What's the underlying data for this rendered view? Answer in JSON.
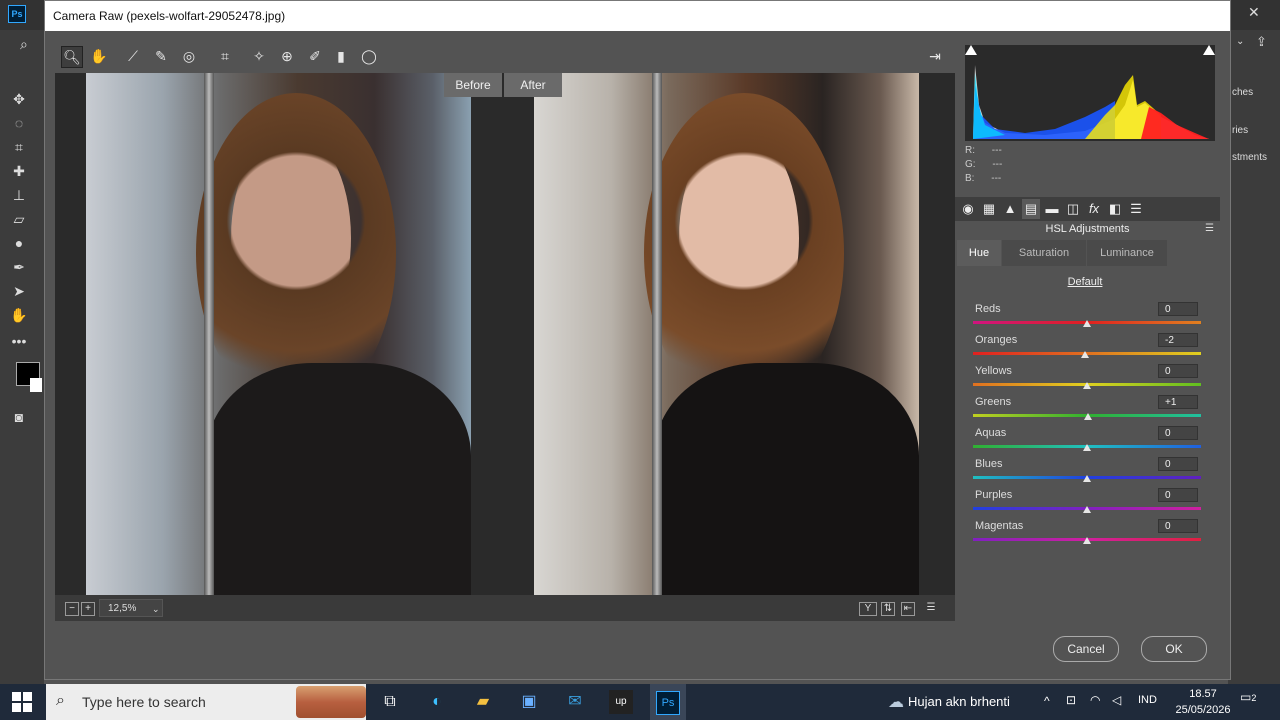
{
  "app": {
    "name": "Photoshop",
    "logo": "Ps"
  },
  "ps_panels": [
    "ches",
    "ries",
    "stments"
  ],
  "dialog": {
    "title": "Camera Raw (pexels-wolfart-29052478.jpg)"
  },
  "compare": {
    "before_label": "Before",
    "after_label": "After"
  },
  "zoom": {
    "value": "12,5%"
  },
  "rgb": {
    "r_label": "R:",
    "r_val": "---",
    "g_label": "G:",
    "g_val": "---",
    "b_label": "B:",
    "b_val": "---"
  },
  "panel": {
    "title": "HSL Adjustments",
    "tabs": [
      "Hue",
      "Saturation",
      "Luminance"
    ],
    "active_tab": "Hue",
    "default_label": "Default",
    "sliders": [
      {
        "label": "Reds",
        "value": "0"
      },
      {
        "label": "Oranges",
        "value": "-2"
      },
      {
        "label": "Yellows",
        "value": "0"
      },
      {
        "label": "Greens",
        "value": "+1"
      },
      {
        "label": "Aquas",
        "value": "0"
      },
      {
        "label": "Blues",
        "value": "0"
      },
      {
        "label": "Purples",
        "value": "0"
      },
      {
        "label": "Magentas",
        "value": "0"
      }
    ]
  },
  "buttons": {
    "cancel": "Cancel",
    "ok": "OK"
  },
  "taskbar": {
    "search_placeholder": "Type here to search",
    "weather": "Hujan akn brhenti",
    "lang": "IND",
    "time": "18.57",
    "date": "25/05/2026",
    "notifications": "2"
  },
  "icons": {
    "tools": [
      "zoom-icon",
      "hand-icon",
      "white-balance-icon",
      "color-sampler-icon",
      "targeted-adjustment-icon",
      "crop-icon",
      "spot-removal-icon",
      "red-eye-icon",
      "adjustment-brush-icon",
      "graduated-filter-icon",
      "radial-filter-icon"
    ],
    "panel_tabs": [
      "basic-icon",
      "tone-curve-icon",
      "detail-icon",
      "hsl-icon",
      "split-toning-icon",
      "lens-corrections-icon",
      "effects-icon",
      "camera-calibration-icon",
      "presets-icon"
    ]
  },
  "colors": {
    "accent": "#31a8ff",
    "panel_bg": "#535353",
    "dialog_bg": "#3a3a3a"
  }
}
